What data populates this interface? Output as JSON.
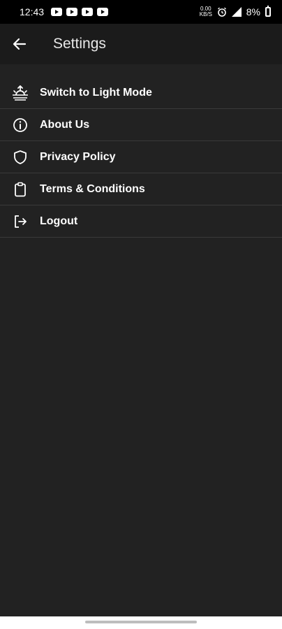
{
  "status_bar": {
    "time": "12:43",
    "notification_icons": [
      "youtube-icon",
      "youtube-icon",
      "youtube-icon",
      "youtube-icon"
    ],
    "speed": "0.00\nKB/S",
    "battery": "8%"
  },
  "app_bar": {
    "title": "Settings",
    "back_icon": "arrow-left-icon"
  },
  "settings": {
    "items": [
      {
        "label": "Switch to Light Mode",
        "icon": "sunrise-icon"
      },
      {
        "label": "About Us",
        "icon": "info-icon"
      },
      {
        "label": "Privacy Policy",
        "icon": "shield-icon"
      },
      {
        "label": "Terms & Conditions",
        "icon": "clipboard-icon"
      },
      {
        "label": "Logout",
        "icon": "logout-icon"
      }
    ]
  },
  "colors": {
    "background": "#222222",
    "app_bar": "#1b1b1b",
    "status_bar": "#000000",
    "text": "#ffffff",
    "divider": "#3a3a3a"
  }
}
